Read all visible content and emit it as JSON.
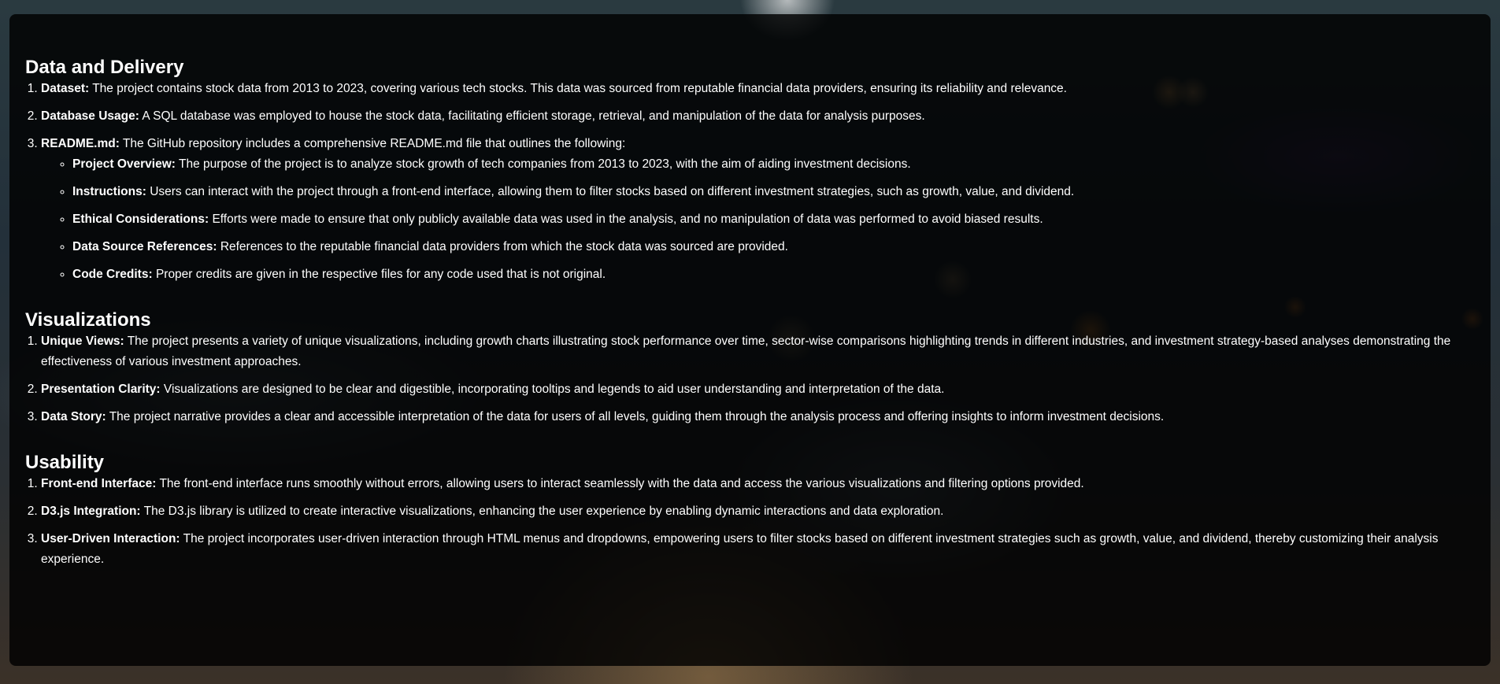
{
  "sections": {
    "data_delivery": {
      "title": "Data and Delivery",
      "items": [
        {
          "label": "Dataset:",
          "text": "The project contains stock data from 2013 to 2023, covering various tech stocks. This data was sourced from reputable financial data providers, ensuring its reliability and relevance."
        },
        {
          "label": "Database Usage:",
          "text": "A SQL database was employed to house the stock data, facilitating efficient storage, retrieval, and manipulation of the data for analysis purposes."
        },
        {
          "label": "README.md:",
          "text": "The GitHub repository includes a comprehensive README.md file that outlines the following:"
        }
      ],
      "readme_items": [
        {
          "label": "Project Overview:",
          "text": "The purpose of the project is to analyze stock growth of tech companies from 2013 to 2023, with the aim of aiding investment decisions."
        },
        {
          "label": "Instructions:",
          "text": "Users can interact with the project through a front-end interface, allowing them to filter stocks based on different investment strategies, such as growth, value, and dividend."
        },
        {
          "label": "Ethical Considerations:",
          "text": "Efforts were made to ensure that only publicly available data was used in the analysis, and no manipulation of data was performed to avoid biased results."
        },
        {
          "label": "Data Source References:",
          "text": "References to the reputable financial data providers from which the stock data was sourced are provided."
        },
        {
          "label": "Code Credits:",
          "text": "Proper credits are given in the respective files for any code used that is not original."
        }
      ]
    },
    "visualizations": {
      "title": "Visualizations",
      "items": [
        {
          "label": "Unique Views:",
          "text": "The project presents a variety of unique visualizations, including growth charts illustrating stock performance over time, sector-wise comparisons highlighting trends in different industries, and investment strategy-based analyses demonstrating the effectiveness of various investment approaches."
        },
        {
          "label": "Presentation Clarity:",
          "text": "Visualizations are designed to be clear and digestible, incorporating tooltips and legends to aid user understanding and interpretation of the data."
        },
        {
          "label": "Data Story:",
          "text": "The project narrative provides a clear and accessible interpretation of the data for users of all levels, guiding them through the analysis process and offering insights to inform investment decisions."
        }
      ]
    },
    "usability": {
      "title": "Usability",
      "items": [
        {
          "label": "Front-end Interface:",
          "text": "The front-end interface runs smoothly without errors, allowing users to interact seamlessly with the data and access the various visualizations and filtering options provided."
        },
        {
          "label": "D3.js Integration:",
          "text": "The D3.js library is utilized to create interactive visualizations, enhancing the user experience by enabling dynamic interactions and data exploration."
        },
        {
          "label": "User-Driven Interaction:",
          "text": "The project incorporates user-driven interaction through HTML menus and dropdowns, empowering users to filter stocks based on different investment strategies such as growth, value, and dividend, thereby customizing their analysis experience."
        }
      ]
    }
  }
}
